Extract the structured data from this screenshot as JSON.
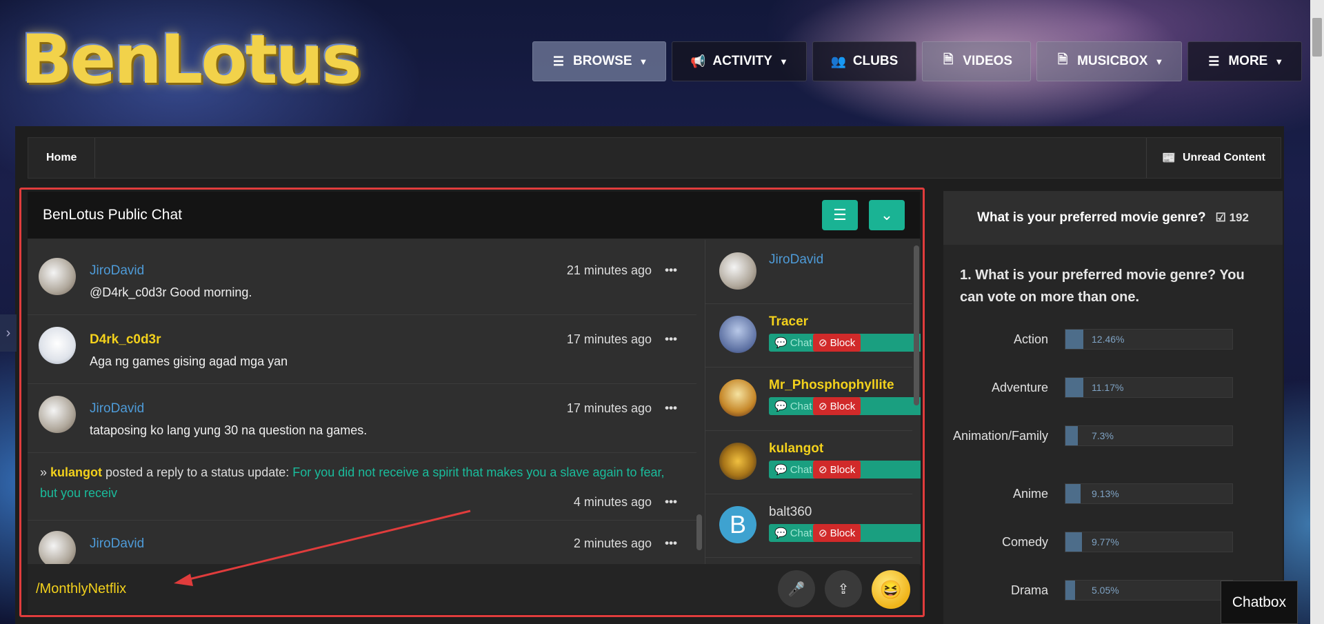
{
  "site": {
    "logo_text": "BenLotus"
  },
  "nav": {
    "items": [
      {
        "label": "BROWSE",
        "icon": "list-icon"
      },
      {
        "label": "ACTIVITY",
        "icon": "megaphone-icon"
      },
      {
        "label": "CLUBS",
        "icon": "users-icon"
      },
      {
        "label": "VIDEOS",
        "icon": "document-icon"
      },
      {
        "label": "MUSICBOX",
        "icon": "document-icon"
      },
      {
        "label": "MORE",
        "icon": "menu-icon"
      }
    ]
  },
  "breadcrumb": {
    "home": "Home",
    "unread": "Unread Content"
  },
  "chat": {
    "title": "BenLotus Public Chat",
    "messages": [
      {
        "name": "JiroDavid",
        "time": "21 minutes ago",
        "text": "@D4rk_c0d3r Good morning."
      },
      {
        "name": "D4rk_c0d3r",
        "time": "17 minutes ago",
        "text": "Aga ng games gising agad mga yan"
      },
      {
        "name": "JiroDavid",
        "time": "17 minutes ago",
        "text": "tataposing ko lang yung 30 na question na games."
      },
      {
        "name": "kulangot",
        "action": "posted a reply to a status update:",
        "link": "For you did not receive a spirit that makes you a slave again to fear, but you receiv",
        "time": "4 minutes ago"
      },
      {
        "name": "JiroDavid",
        "time": "2 minutes ago",
        "text": ""
      }
    ],
    "more_glyph": "•••",
    "users": [
      {
        "name": "JiroDavid"
      },
      {
        "name": "Tracer",
        "chat": "Chat",
        "block": "Block"
      },
      {
        "name": "Mr_Phosphophyllite",
        "chat": "Chat",
        "block": "Block"
      },
      {
        "name": "kulangot",
        "chat": "Chat",
        "block": "Block"
      },
      {
        "name": "balt360",
        "initial": "B",
        "chat": "Chat",
        "block": "Block"
      }
    ],
    "input_value": "/MonthlyNetflix"
  },
  "poll": {
    "title": "What is your preferred movie genre?",
    "votes": "192",
    "question": "1. What is your preferred movie genre? You can vote on more than one.",
    "options": [
      {
        "label": "Action",
        "pct": "12.46%"
      },
      {
        "label": "Adventure",
        "pct": "11.17%"
      },
      {
        "label": "Animation/Family",
        "pct": "7.3%"
      },
      {
        "label": "Anime",
        "pct": "9.13%"
      },
      {
        "label": "Comedy",
        "pct": "9.77%"
      },
      {
        "label": "Drama",
        "pct": "5.05%"
      }
    ]
  },
  "chatbox_tab": "Chatbox",
  "colors": {
    "accent": "#1ab394",
    "highlight": "#e03c3c",
    "gold_name": "#f3d11c",
    "link_blue": "#4e9bd8"
  }
}
